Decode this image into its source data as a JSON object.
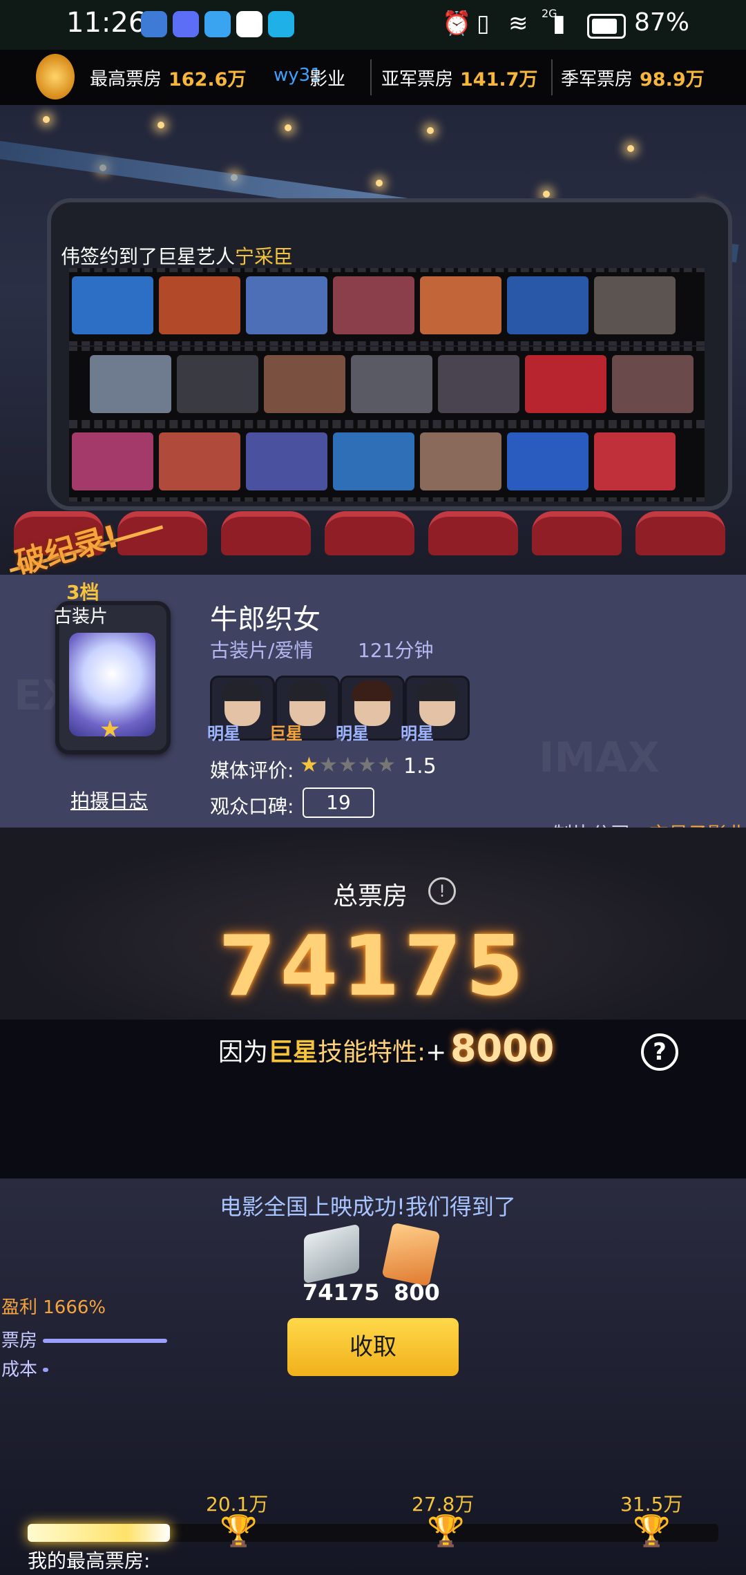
{
  "status_bar": {
    "time": "11:26",
    "signal": "2G",
    "battery": "87%"
  },
  "rank_bar": {
    "highest_label": "最高票房",
    "highest_value": "162.6万",
    "studio_prefix": "wy31",
    "studio_suffix": "影业",
    "second_label": "亚军票房",
    "second_value": "141.7万",
    "third_label": "季军票房",
    "third_value": "98.9万"
  },
  "ticker": {
    "prefix": "伟签约到了巨星艺人",
    "highlight": "宁采臣"
  },
  "record_banner": "破纪录!",
  "movie": {
    "tier": "3档",
    "genre_badge": "古装片",
    "log_link": "拍摄日志",
    "title": "牛郎织女",
    "genre": "古装片/爱情",
    "duration": "121分钟",
    "actors": [
      {
        "tag": "明星",
        "color": "#9fb4ff"
      },
      {
        "tag": "巨星",
        "color": "#f6a43c"
      },
      {
        "tag": "明星",
        "color": "#9fb4ff"
      },
      {
        "tag": "明星",
        "color": "#9fb4ff"
      }
    ],
    "media_label": "媒体评价:",
    "media_score": "1.5",
    "media_stars": 0.3,
    "audience_label": "观众口碑:",
    "audience_value": "19",
    "studio_label": "制片公司:",
    "studio_name": "玄易子影业"
  },
  "box_office": {
    "label": "总票房",
    "value": "74175",
    "bonus_prefix": "因为",
    "bonus_highlight": "巨星",
    "bonus_skill": "技能特性:",
    "bonus_plus": "+",
    "bonus_value": "8000"
  },
  "result": {
    "message": "电影全国上映成功!我们得到了",
    "money": "74175",
    "cards": "800",
    "profit": "盈利 1666%",
    "box_label": "票房",
    "cost_label": "成本",
    "collect_button": "收取"
  },
  "progress": {
    "milestones": [
      "20.1万",
      "27.8万",
      "31.5万"
    ],
    "my_best_label": "我的最高票房:",
    "fill_fraction": 0.206
  },
  "colors": {
    "accent_gold": "#f6c43c",
    "accent_orange": "#f6a43c",
    "panel": "#3f4260"
  }
}
